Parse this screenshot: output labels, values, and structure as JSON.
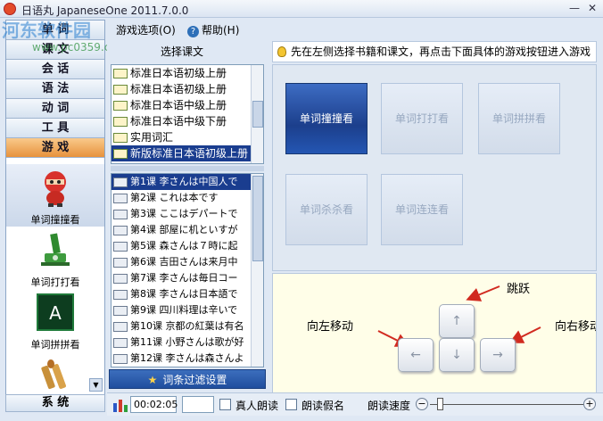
{
  "window": {
    "title": "日语丸 JapaneseOne 2011.7.0.0",
    "min_label": "—",
    "close_label": "✕"
  },
  "watermark": {
    "site": "河东软件园",
    "url": "www.pc0359.cn"
  },
  "menubar": {
    "options_label": "游戏选项(O)",
    "help_label": "帮助(H)"
  },
  "sidebar": {
    "items": [
      {
        "label": "单 词",
        "active": false
      },
      {
        "label": "课 文",
        "active": false
      },
      {
        "label": "会 话",
        "active": false
      },
      {
        "label": "语 法",
        "active": false
      },
      {
        "label": "动 词",
        "active": false
      },
      {
        "label": "工 具",
        "active": false
      },
      {
        "label": "游 戏",
        "active": true
      }
    ],
    "games": [
      {
        "label": "单词撞撞看",
        "icon": "ninja-icon",
        "selected": true
      },
      {
        "label": "单词打打看",
        "icon": "cannon-icon",
        "selected": false
      },
      {
        "label": "单词拼拼看",
        "icon": "letter-a-icon",
        "selected": false
      },
      {
        "label": "",
        "icon": "bullets-icon",
        "selected": false
      }
    ],
    "system_label": "系 统"
  },
  "books": {
    "header": "选择课文",
    "items": [
      {
        "label": "标准日本语初级上册",
        "selected": false
      },
      {
        "label": "标准日本语初级上册",
        "selected": false
      },
      {
        "label": "标准日本语中级上册",
        "selected": false
      },
      {
        "label": "标准日本语中级下册",
        "selected": false
      },
      {
        "label": "实用词汇",
        "selected": false
      },
      {
        "label": "新版标准日本语初级上册",
        "selected": true
      }
    ]
  },
  "lessons": {
    "items": [
      {
        "label": "第1课 李さんは中国人で",
        "selected": true
      },
      {
        "label": "第2课 これは本です",
        "selected": false
      },
      {
        "label": "第3课 ここはデパートで",
        "selected": false
      },
      {
        "label": "第4课 部屋に机といすが",
        "selected": false
      },
      {
        "label": "第5课 森さんは７時に起",
        "selected": false
      },
      {
        "label": "第6课 吉田さんは来月中",
        "selected": false
      },
      {
        "label": "第7课 李さんは毎日コー",
        "selected": false
      },
      {
        "label": "第8课 李さんは日本語で",
        "selected": false
      },
      {
        "label": "第9课 四川料理は辛いで",
        "selected": false
      },
      {
        "label": "第10课 京都の紅葉は有名",
        "selected": false
      },
      {
        "label": "第11课 小野さんは歌が好",
        "selected": false
      },
      {
        "label": "第12课 李さんは森さんよ",
        "selected": false
      }
    ],
    "filter_label": "词条过滤设置"
  },
  "hint": "先在左侧选择书籍和课文，再点击下面具体的游戏按钮进入游戏",
  "game_buttons": [
    {
      "label": "单词撞撞看",
      "active": true
    },
    {
      "label": "单词打打看",
      "active": false
    },
    {
      "label": "单词拼拼看",
      "active": false
    },
    {
      "label": "单词杀杀看",
      "active": false
    },
    {
      "label": "单词连连看",
      "active": false
    }
  ],
  "keys": {
    "jump": "跳跃",
    "left": "向左移动",
    "right": "向右移动",
    "up": "↑",
    "down": "↓",
    "leftkey": "←",
    "rightkey": "→"
  },
  "status": {
    "time": "00:02:05",
    "real_read": "真人朗读",
    "read_kana": "朗读假名",
    "speed_label": "朗读速度",
    "minus": "−",
    "plus": "+"
  }
}
